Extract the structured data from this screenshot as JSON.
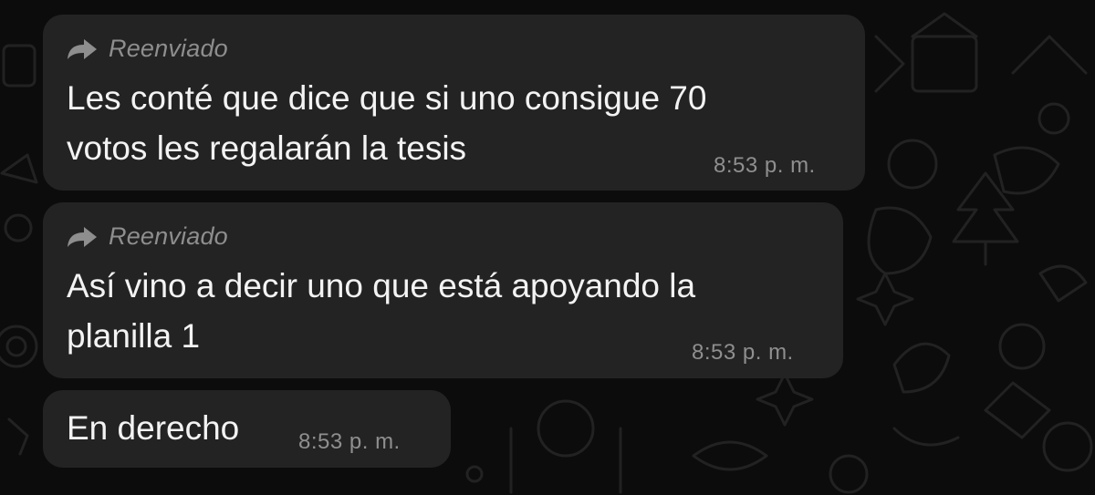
{
  "messages": [
    {
      "forwarded_label": "Reenviado",
      "text": "Les conté que dice que si uno consigue 70\nvotos les regalarán la tesis",
      "time": "8:53 p. m."
    },
    {
      "forwarded_label": "Reenviado",
      "text": "Así vino a decir uno que está apoyando la\nplanilla 1",
      "time": "8:53 p. m."
    },
    {
      "text": "En derecho",
      "time": "8:53 p. m."
    }
  ],
  "icons": {
    "forward": "forward-arrow-icon"
  },
  "colors": {
    "background": "#0c0c0c",
    "bubble": "#232323",
    "text": "#f3f3f3",
    "meta": "#8e8e8e"
  }
}
